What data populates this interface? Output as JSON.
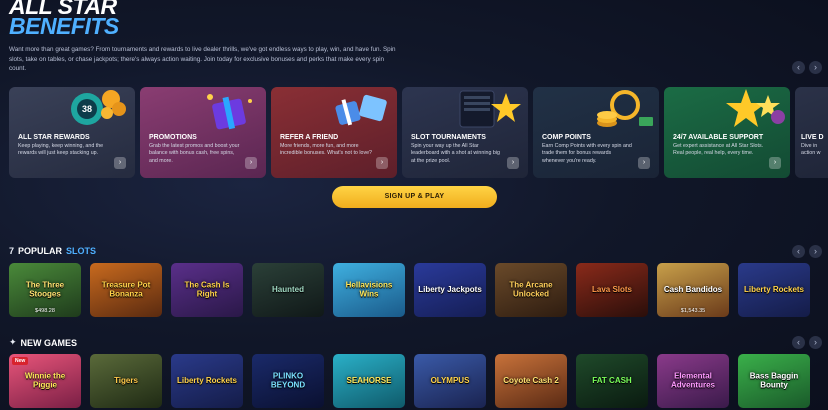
{
  "hero": {
    "title_line1": "ALL STAR",
    "title_line2": "BENEFITS",
    "intro": "Want more than great games? From tournaments and rewards to live dealer thrills, we've got endless ways to play, win, and have fun. Spin slots, take on tables, or chase jackpots; there's always action waiting. Join today for exclusive bonuses and perks that make every spin count."
  },
  "nav_arrows": {
    "prev": "‹",
    "next": "›"
  },
  "benefits": [
    {
      "title": "All Star Rewards",
      "desc": "Keep playing, keep winning, and the rewards will just keep stacking up.",
      "art": "chip-icon"
    },
    {
      "title": "Promotions",
      "desc": "Grab the latest promos and boost your balance with bonus cash, free spins, and more.",
      "art": "gift-icon"
    },
    {
      "title": "Refer a Friend",
      "desc": "More friends, more fun, and more incredible bonuses. What's not to love?",
      "art": "gifts-icon"
    },
    {
      "title": "Slot Tournaments",
      "desc": "Spin your way up the All Star leaderboard with a shot at winning big at the prize pool.",
      "art": "star-icon"
    },
    {
      "title": "Comp Points",
      "desc": "Earn Comp Points with every spin and trade them for bonus rewards whenever you're ready.",
      "art": "coins-icon"
    },
    {
      "title": "24/7 Available Support",
      "desc": "Get expert assistance at All Star Slots. Real people, real help, every time.",
      "art": "stars-icon"
    },
    {
      "title": "Live D",
      "desc": "Dive in action w",
      "art": ""
    }
  ],
  "signup": {
    "label": "SIGN UP & PLAY"
  },
  "popular": {
    "icon": "7",
    "title_part1": "POPULAR",
    "title_part2": "SLOTS",
    "games": [
      {
        "title": "The Three Stooges",
        "amount": "$498.28"
      },
      {
        "title": "Treasure Pot Bonanza",
        "amount": ""
      },
      {
        "title": "The Cash Is Right",
        "amount": ""
      },
      {
        "title": "Haunted",
        "amount": ""
      },
      {
        "title": "Hellavisions Wins",
        "amount": ""
      },
      {
        "title": "Liberty Jackpots",
        "amount": ""
      },
      {
        "title": "The Arcane Unlocked",
        "amount": ""
      },
      {
        "title": "Lava Slots",
        "amount": ""
      },
      {
        "title": "Cash Bandidos",
        "amount": "$1,543.35"
      },
      {
        "title": "Liberty Rockets",
        "amount": ""
      }
    ]
  },
  "new_games": {
    "title": "NEW GAMES",
    "badge": "New",
    "games": [
      {
        "title": "Winnie the Piggie"
      },
      {
        "title": "Tigers"
      },
      {
        "title": "Liberty Rockets"
      },
      {
        "title": "PLINKO BEYOND"
      },
      {
        "title": "SEAHORSE"
      },
      {
        "title": "OLYMPUS"
      },
      {
        "title": "Coyote Cash 2"
      },
      {
        "title": "FAT CASH"
      },
      {
        "title": "Elemental Adventures"
      },
      {
        "title": "Bass Baggin Bounty"
      }
    ]
  }
}
